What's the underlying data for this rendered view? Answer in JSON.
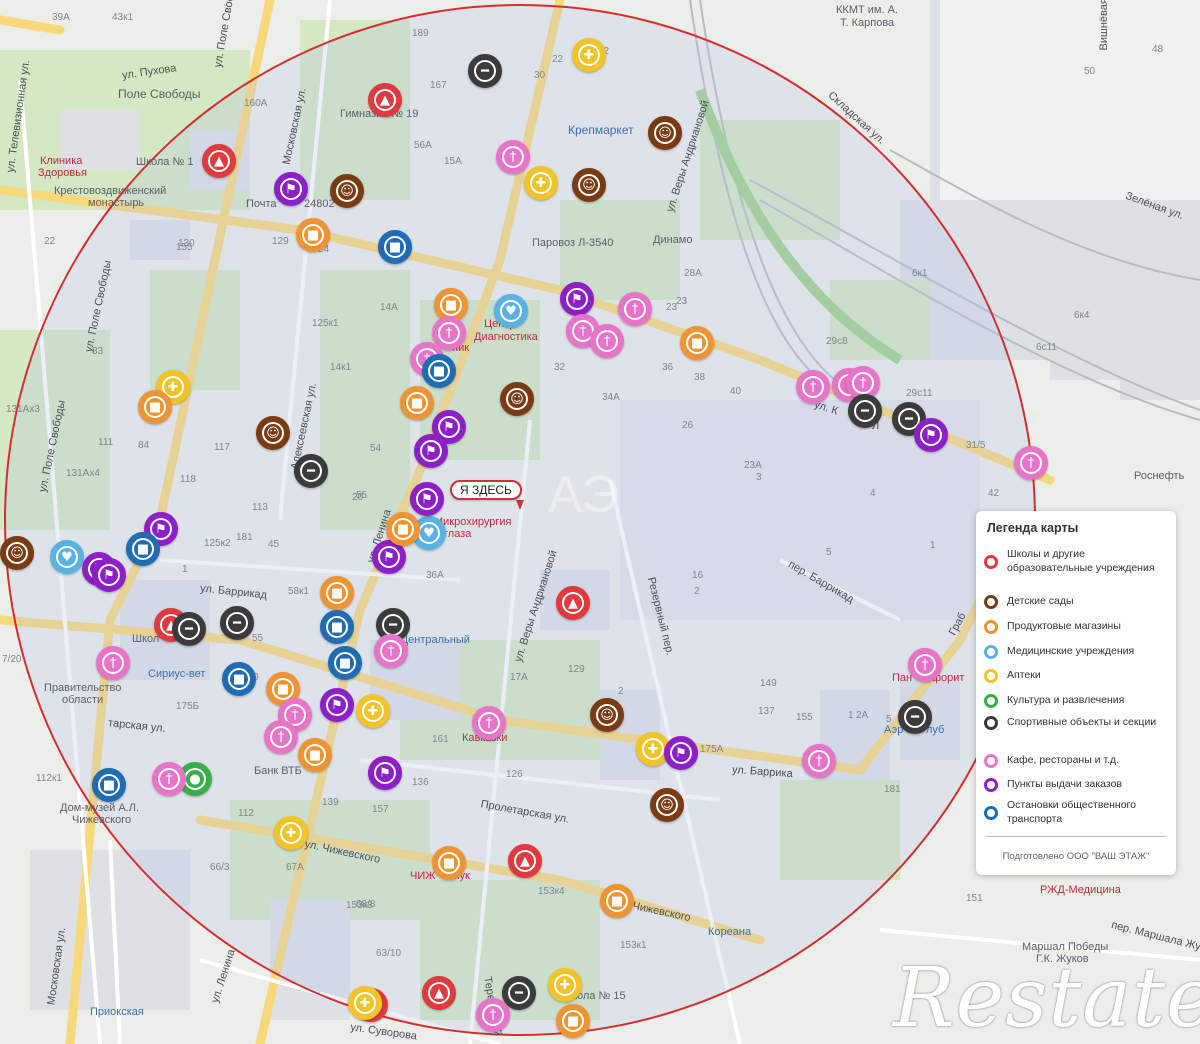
{
  "map": {
    "here_label": "Я ЗДЕСЬ",
    "colors": {
      "school": "#e0393e",
      "kindergarten": "#7a3b13",
      "grocery": "#f09433",
      "medical": "#58b3e2",
      "pharmacy": "#f3c428",
      "culture": "#3aae49",
      "sport": "#3b3b3b",
      "cafe": "#e874c9",
      "pickup": "#8d1fc8",
      "transport": "#1f6bb4",
      "radius": "#d62d2d"
    },
    "labels": {
      "kkmt": "ККМТ им. А.",
      "karpova": "Т. Карпова",
      "pukhova": "ул. Пухова",
      "pole_svobody_street": "ул. Поле Своб",
      "pole_svobody": "Поле Свободы",
      "televiz": "ул. Телевизионная ул.",
      "moskovskaya_top": "Московская ул.",
      "gimnaziya": "Гимназия № 19",
      "klinika": "Клиника",
      "zdorovya": "Здоровья",
      "shkola1": "Школа № 1",
      "krestovozdv": "Крестовоздвиженский",
      "monastyr": "монастырь",
      "pochta": "Почта",
      "pochta_num": "24802",
      "krepmarket": "Крепмаркет",
      "paravoz": "Паровоз Л-3540",
      "dinamo": "Динамо",
      "skladskaya": "Складская ул.",
      "zelenaya": "Зелёная ул.",
      "vishnevaya": "Вишнёвая",
      "very_andrianovoy_top": "ул. Веры Андриановой",
      "tsentr": "Центр",
      "diagnostika": "Диагностика",
      "zelenaya2": "ник",
      "rosneft": "Роснефть",
      "kaluzhskaya": "ул. К",
      "kaluzhskaya_end": "Л",
      "pole_svobody_vert": "ул. Поле Свободы",
      "alekseevskaya": "Алексеевская ул.",
      "lenina_mid": "ул. Ленина",
      "very_andr_mid": "ул. Веры Андриановой",
      "mikrokhirurgiya": "Микрохирургия",
      "glaza": "глаза",
      "rezervny": "Резервный пер.",
      "barrikad_per": "пер. Баррикад",
      "barrikad_ul": "ул. Баррикад",
      "grab": "Граб",
      "shkola_left": "Школ",
      "tsentralny": "Центральный",
      "sirius": "Сириус-вет",
      "pravitelstvo": "Правительство",
      "oblasti": "области",
      "pan": "Пан",
      "forit": "форит",
      "aeroklub": "Аэр",
      "klub": "луб",
      "tarskaya": "тарская ул.",
      "kavkazki": "Кавказки",
      "barrik_right": "ул. Баррика",
      "bank": "Банк ВТБ",
      "dom_muzey1": "Дом-музей А.Л.",
      "dom_muzey2": "Чижевского",
      "proletarskaya": "Пролетарская ул.",
      "chizh_ul": "ул. Чижевского",
      "chizh_top": "ЧИЖ",
      "chizh_shop": "жук",
      "chizh_right": "Чижевского",
      "koreana": "Кореана",
      "rzd": "РЖД-Медицина",
      "marshal1": "Маршал Победы",
      "marshal2": "Г.К. Жуков",
      "marshala_per": "пер. Маршала Жу",
      "moskovskaya_bottom": "Московская ул.",
      "lenina_bottom": "ул. Ленина",
      "terepetsky": "Терепецкий",
      "shkola15": "Школа № 15",
      "priokskaya": "Приокская",
      "suvorova": "ул. Суворова"
    },
    "buildings": [
      "39А",
      "43к1",
      "189",
      "167",
      "30",
      "22",
      "12",
      "160А",
      "15А",
      "129",
      "130",
      "14А",
      "125к1",
      "14к1",
      "32",
      "34А",
      "38",
      "40",
      "36",
      "34",
      "26",
      "23",
      "23",
      "6к1",
      "6к4",
      "6с11",
      "29с8",
      "29с11",
      "31/5",
      "42",
      "3",
      "5",
      "83",
      "84",
      "117",
      "118",
      "113",
      "125к2",
      "111",
      "131Ах4",
      "131Ах3",
      "36А",
      "55",
      "54",
      "45",
      "58к1",
      "55",
      "129",
      "17А",
      "149",
      "137",
      "2",
      "2А",
      "155",
      "181",
      "175А",
      "175Б",
      "161",
      "126",
      "136",
      "157",
      "139",
      "112",
      "112к1",
      "66/3",
      "67А",
      "68/8",
      "63/10",
      "153к3",
      "153к4",
      "153к1",
      "155",
      "7/20",
      "120",
      "151",
      "16",
      "2",
      "1",
      "23А",
      "4",
      "5",
      "1",
      "2",
      "1",
      "181",
      "24",
      "22",
      "20",
      "28А",
      "48",
      "50",
      "56А",
      "4",
      "19",
      "14к1"
    ],
    "markers": [
      {
        "type": "sport"
      },
      {
        "type": "pharmacy"
      },
      {
        "type": "school"
      },
      {
        "type": "kindergarten"
      },
      {
        "type": "cafe"
      },
      {
        "type": "pharmacy"
      },
      {
        "type": "kindergarten"
      },
      {
        "type": "school"
      },
      {
        "type": "pickup"
      },
      {
        "type": "kindergarten"
      },
      {
        "type": "grocery"
      },
      {
        "type": "transport"
      },
      {
        "type": "grocery"
      },
      {
        "type": "medical"
      },
      {
        "type": "pickup"
      },
      {
        "type": "cafe"
      },
      {
        "type": "cafe"
      },
      {
        "type": "cafe"
      },
      {
        "type": "cafe"
      },
      {
        "type": "grocery"
      },
      {
        "type": "cafe"
      },
      {
        "type": "transport"
      },
      {
        "type": "cafe"
      },
      {
        "type": "grocery"
      },
      {
        "type": "pharmacy"
      },
      {
        "type": "kindergarten"
      },
      {
        "type": "grocery"
      },
      {
        "type": "pickup"
      },
      {
        "type": "pickup"
      },
      {
        "type": "cafe"
      },
      {
        "type": "cafe"
      },
      {
        "type": "sport"
      },
      {
        "type": "sport"
      },
      {
        "type": "pickup"
      },
      {
        "type": "cafe"
      },
      {
        "type": "kindergarten"
      },
      {
        "type": "sport"
      },
      {
        "type": "pickup"
      },
      {
        "type": "medical"
      },
      {
        "type": "pickup"
      },
      {
        "type": "pickup"
      },
      {
        "type": "transport"
      },
      {
        "type": "medical"
      },
      {
        "type": "kindergarten"
      },
      {
        "type": "grocery"
      },
      {
        "type": "pickup"
      },
      {
        "type": "pickup"
      },
      {
        "type": "grocery"
      },
      {
        "type": "transport"
      },
      {
        "type": "sport"
      },
      {
        "type": "cafe"
      },
      {
        "type": "transport"
      },
      {
        "type": "school"
      },
      {
        "type": "sport"
      },
      {
        "type": "sport"
      },
      {
        "type": "cafe"
      },
      {
        "type": "transport"
      },
      {
        "type": "cafe"
      },
      {
        "type": "grocery"
      },
      {
        "type": "pickup"
      },
      {
        "type": "pharmacy"
      },
      {
        "type": "cafe"
      },
      {
        "type": "cafe"
      },
      {
        "type": "grocery"
      },
      {
        "type": "cafe"
      },
      {
        "type": "kindergarten"
      },
      {
        "type": "pharmacy"
      },
      {
        "type": "pickup"
      },
      {
        "type": "cafe"
      },
      {
        "type": "sport"
      },
      {
        "type": "transport"
      },
      {
        "type": "culture"
      },
      {
        "type": "cafe"
      },
      {
        "type": "pickup"
      },
      {
        "type": "kindergarten"
      },
      {
        "type": "pharmacy"
      },
      {
        "type": "grocery"
      },
      {
        "type": "school"
      },
      {
        "type": "grocery"
      },
      {
        "type": "school"
      },
      {
        "type": "sport"
      },
      {
        "type": "school"
      },
      {
        "type": "pharmacy"
      },
      {
        "type": "school"
      },
      {
        "type": "grocery"
      },
      {
        "type": "cafe"
      },
      {
        "type": "pharmacy"
      }
    ]
  },
  "legend": {
    "title": "Легенда карты",
    "items": [
      {
        "label": "Школы и другие образовательные учреждения",
        "color": "#e0393e"
      },
      {
        "label": "Детские сады",
        "color": "#7a3b13"
      },
      {
        "label": "Продуктовые магазины",
        "color": "#f09433"
      },
      {
        "label": "Медицинские учреждения",
        "color": "#58b3e2"
      },
      {
        "label": "Аптеки",
        "color": "#f3c428"
      },
      {
        "label": "Культура и развлечения",
        "color": "#3aae49"
      },
      {
        "label": "Спортивные объекты и секции",
        "color": "#3b3b3b"
      },
      {
        "label": "Кафе, рестораны и т.д.",
        "color": "#e874c9"
      },
      {
        "label": "Пункты выдачи заказов",
        "color": "#8d1fc8"
      },
      {
        "label": "Остановки общественного транспорта",
        "color": "#1f6bb4"
      }
    ],
    "credit": "Подготовлено ООО \"ВАШ ЭТАЖ\""
  },
  "watermark": {
    "brand": "Restate",
    "overlay": "АЭ"
  }
}
